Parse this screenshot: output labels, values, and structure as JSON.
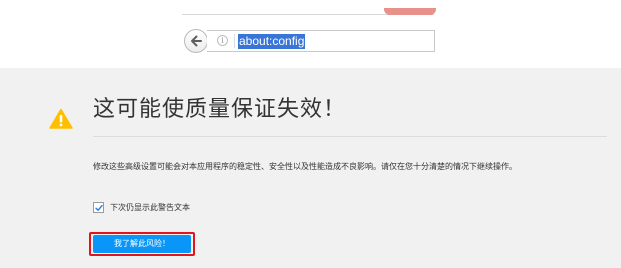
{
  "browser": {
    "url": "about:config",
    "icons": {
      "back": "back-arrow-icon",
      "info": "info-icon"
    }
  },
  "warning": {
    "title": "这可能使质量保证失效！",
    "description": "修改这些高级设置可能会对本应用程序的稳定性、安全性以及性能造成不良影响。请仅在您十分清楚的情况下继续操作。",
    "show_warning": {
      "label": "下次仍显示此警告文本",
      "checked": true
    },
    "accept_button_label": "我了解此风险！",
    "icon": "warning-triangle-icon"
  },
  "colors": {
    "warning_yellow": "#ffbf00",
    "button_blue": "#0996f8",
    "highlight_red": "#e4141c",
    "selection_blue": "#3875d7"
  }
}
